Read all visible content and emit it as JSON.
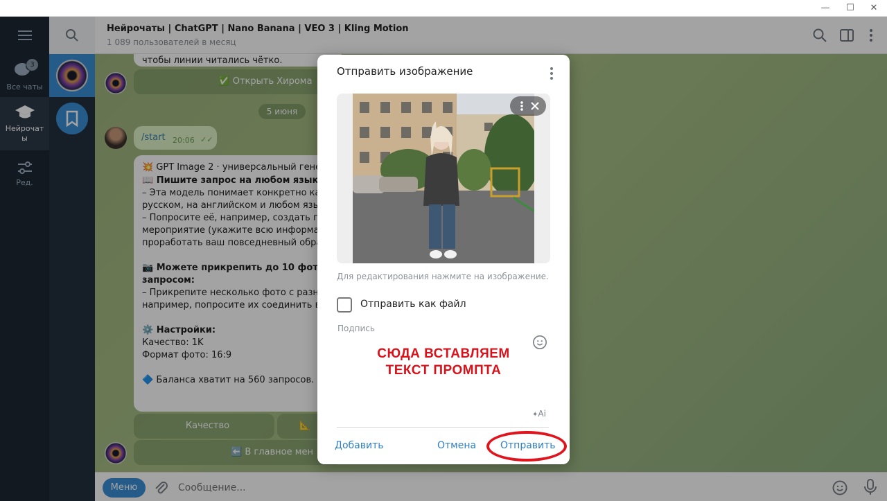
{
  "window": {
    "minimize": "—",
    "maximize": "☐",
    "close": "✕"
  },
  "rail": {
    "items": [
      {
        "label": "Все чаты",
        "badge": "3",
        "icon": "chat-bubbles-icon"
      },
      {
        "label": "Нейрочаты",
        "icon": "graduation-cap-icon"
      },
      {
        "label": "Ред.",
        "icon": "sliders-icon"
      }
    ]
  },
  "header": {
    "title": "Нейрочаты | ChatGPT | Nano Banana | VEO 3 | Kling Motion",
    "subtitle": "1 089 пользователей в месяц"
  },
  "chat": {
    "top_text": "чтобы линии читались чётко.",
    "open_button": "✅ Открыть Хирома",
    "date": "5 июня",
    "start_msg": {
      "text": "/start",
      "time": "20:06",
      "status": "✓✓"
    },
    "bot_msg": {
      "headline": "💥 GPT Image 2 · универсальный генера",
      "lines": [
        "📖 Пишите запрос на любом языке:",
        "– Эта модель понимает конкретно кажд",
        "русском, на английском и любом языке;",
        "– Попросите её, например, создать посте",
        "мероприятие (укажите всю информаци",
        "проработать ваш повседневный образ.",
        "",
        "📷 Можете прикрепить до 10 фото в од",
        "запросом:",
        "– Прикрепите несколько фото с разным",
        "например, попросите их соединить во ч",
        "",
        "⚙️ Настройки:",
        "Качество: 1K",
        "Формат фото: 16:9",
        "",
        "🔷 Баланса хватит на 560 запросов. 1 фо"
      ]
    },
    "quality_button": "Качество",
    "format_button_glyph": "📐",
    "main_menu_button": "⬅️ В главное мен"
  },
  "composer": {
    "menu": "Меню",
    "placeholder": "Сообщение..."
  },
  "dialog": {
    "title": "Отправить изображение",
    "hint": "Для редактирования нажмите на изображение.",
    "send_as_file": "Отправить как файл",
    "caption_label": "Подпись",
    "prompt_line1": "СЮДА ВСТАВЛЯЕМ",
    "prompt_line2": "ТЕКСТ ПРОМПТА",
    "ai_label": "Ai",
    "add": "Добавить",
    "cancel": "Отмена",
    "send": "Отправить"
  },
  "colors": {
    "accent": "#3a8fd6",
    "highlight": "#e0141c",
    "prompt": "#d8121b"
  }
}
